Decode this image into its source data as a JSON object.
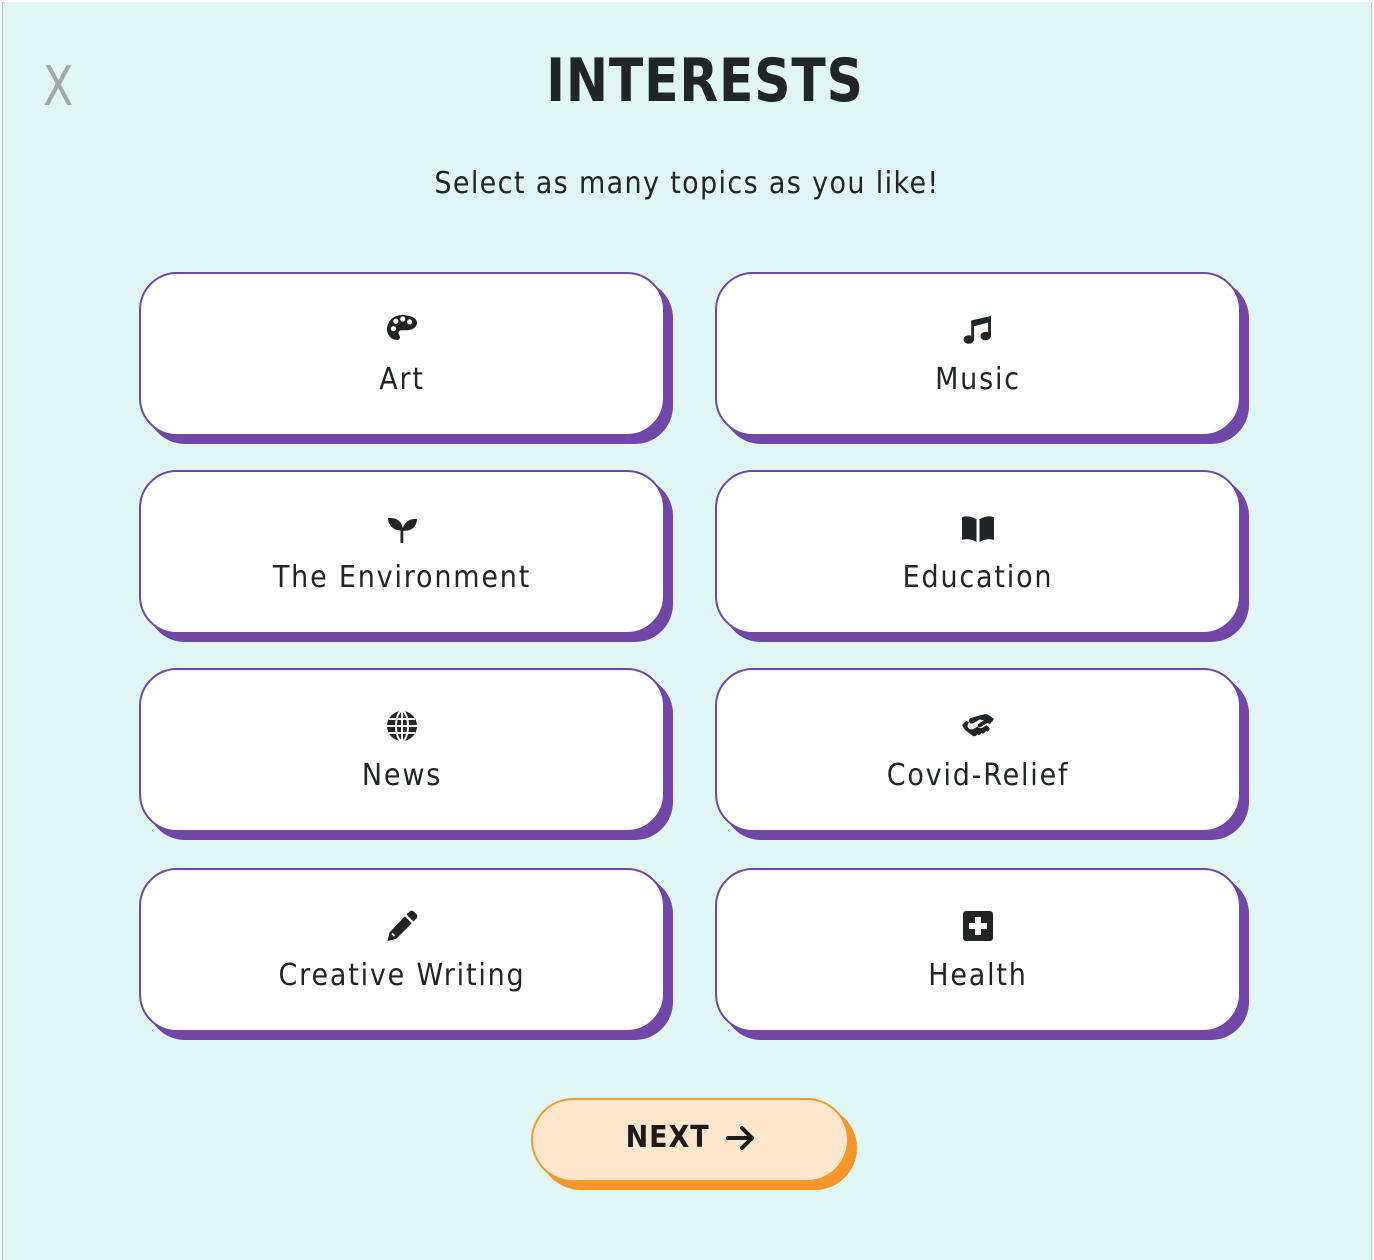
{
  "modal": {
    "close_label": "X",
    "title": "INTERESTS",
    "subtitle": "Select as many topics as you like!"
  },
  "topics": [
    {
      "label": "Art",
      "icon": "palette-icon"
    },
    {
      "label": "Music",
      "icon": "music-note-icon"
    },
    {
      "label": "The Environment",
      "icon": "seedling-icon"
    },
    {
      "label": "Education",
      "icon": "book-open-icon"
    },
    {
      "label": "News",
      "icon": "globe-icon"
    },
    {
      "label": "Covid-Relief",
      "icon": "handshake-icon"
    },
    {
      "label": "Creative Writing",
      "icon": "pencil-icon"
    },
    {
      "label": "Health",
      "icon": "medical-plus-icon"
    }
  ],
  "next_button": {
    "label": "NEXT",
    "icon": "arrow-right-icon"
  },
  "colors": {
    "background": "#dff6f4",
    "card_border": "#7046a6",
    "next_fill": "#ffe6cc",
    "next_border": "#f39a2e",
    "text": "#222528",
    "close": "#a6a6a6"
  }
}
